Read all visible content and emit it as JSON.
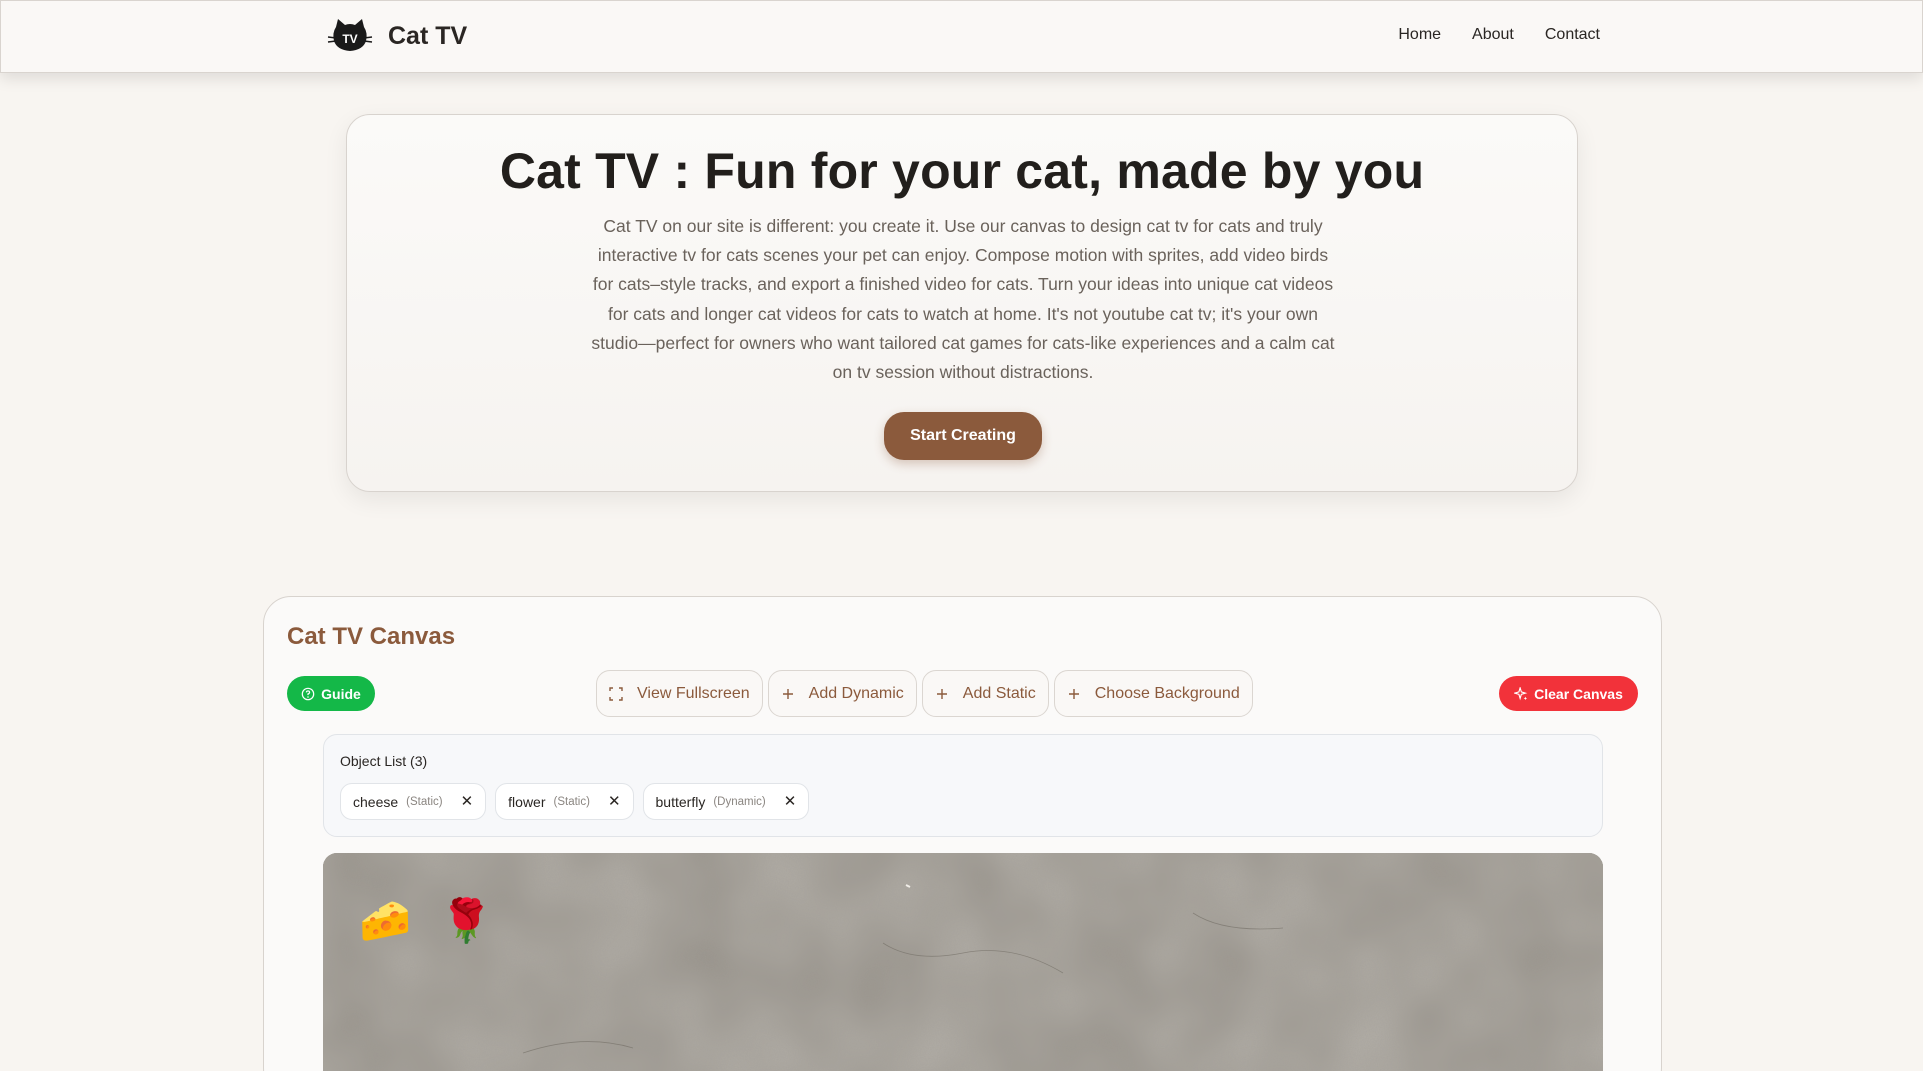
{
  "header": {
    "brand": "Cat TV",
    "logo_icon": "cat-tv-logo-icon",
    "nav": [
      "Home",
      "About",
      "Contact"
    ]
  },
  "hero": {
    "title": "Cat TV : Fun for your cat, made by you",
    "description": "Cat TV on our site is different: you create it. Use our canvas to design cat tv for cats and truly interactive tv for cats scenes your pet can enjoy. Compose motion with sprites, add video birds for cats–style tracks, and export a finished video for cats. Turn your ideas into unique cat videos for cats and longer cat videos for cats to watch at home. It's not youtube cat tv; it's your own studio—perfect for owners who want tailored cat games for cats-like experiences and a calm cat on tv session without distractions.",
    "cta_label": "Start Creating"
  },
  "canvas": {
    "title": "Cat TV Canvas",
    "guide_label": "Guide",
    "toolbar": {
      "fullscreen_label": "View Fullscreen",
      "add_dynamic_label": "Add Dynamic",
      "add_static_label": "Add Static",
      "choose_background_label": "Choose Background"
    },
    "clear_label": "Clear Canvas",
    "object_list": {
      "title": "Object List (3)",
      "items": [
        {
          "name": "cheese",
          "type": "(Static)"
        },
        {
          "name": "flower",
          "type": "(Static)"
        },
        {
          "name": "butterfly",
          "type": "(Dynamic)"
        }
      ]
    },
    "sprites": {
      "cheese": "🧀",
      "flower": "🌹"
    }
  },
  "colors": {
    "brand_brown": "#8b5a3c",
    "guide_green": "#14b848",
    "clear_red": "#f2323a",
    "page_bg": "#f8f5f1"
  }
}
